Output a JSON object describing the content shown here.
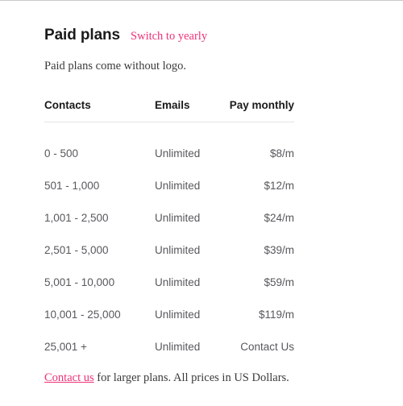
{
  "header": {
    "title": "Paid plans",
    "switch_link": "Switch to yearly",
    "subtitle": "Paid plans come without logo."
  },
  "table": {
    "columns": {
      "contacts": "Contacts",
      "emails": "Emails",
      "price": "Pay monthly"
    },
    "rows": [
      {
        "contacts": "0 - 500",
        "emails": "Unlimited",
        "price": "$8/m"
      },
      {
        "contacts": "501 - 1,000",
        "emails": "Unlimited",
        "price": "$12/m"
      },
      {
        "contacts": "1,001 - 2,500",
        "emails": "Unlimited",
        "price": "$24/m"
      },
      {
        "contacts": "2,501 - 5,000",
        "emails": "Unlimited",
        "price": "$39/m"
      },
      {
        "contacts": "5,001 - 10,000",
        "emails": "Unlimited",
        "price": "$59/m"
      },
      {
        "contacts": "10,001 - 25,000",
        "emails": "Unlimited",
        "price": "$119/m"
      },
      {
        "contacts": "25,001 +",
        "emails": "Unlimited",
        "price": "Contact Us"
      }
    ]
  },
  "footer": {
    "link_text": "Contact us",
    "rest_text": " for larger plans. All prices in US Dollars."
  },
  "colors": {
    "accent_pink": "#ee3377",
    "heading": "#1a1a1a",
    "body_text": "#3a3a3a",
    "table_text": "#58585d",
    "rule": "#e4e4e4",
    "top_rule": "#c9c9c9",
    "background": "#ffffff"
  }
}
